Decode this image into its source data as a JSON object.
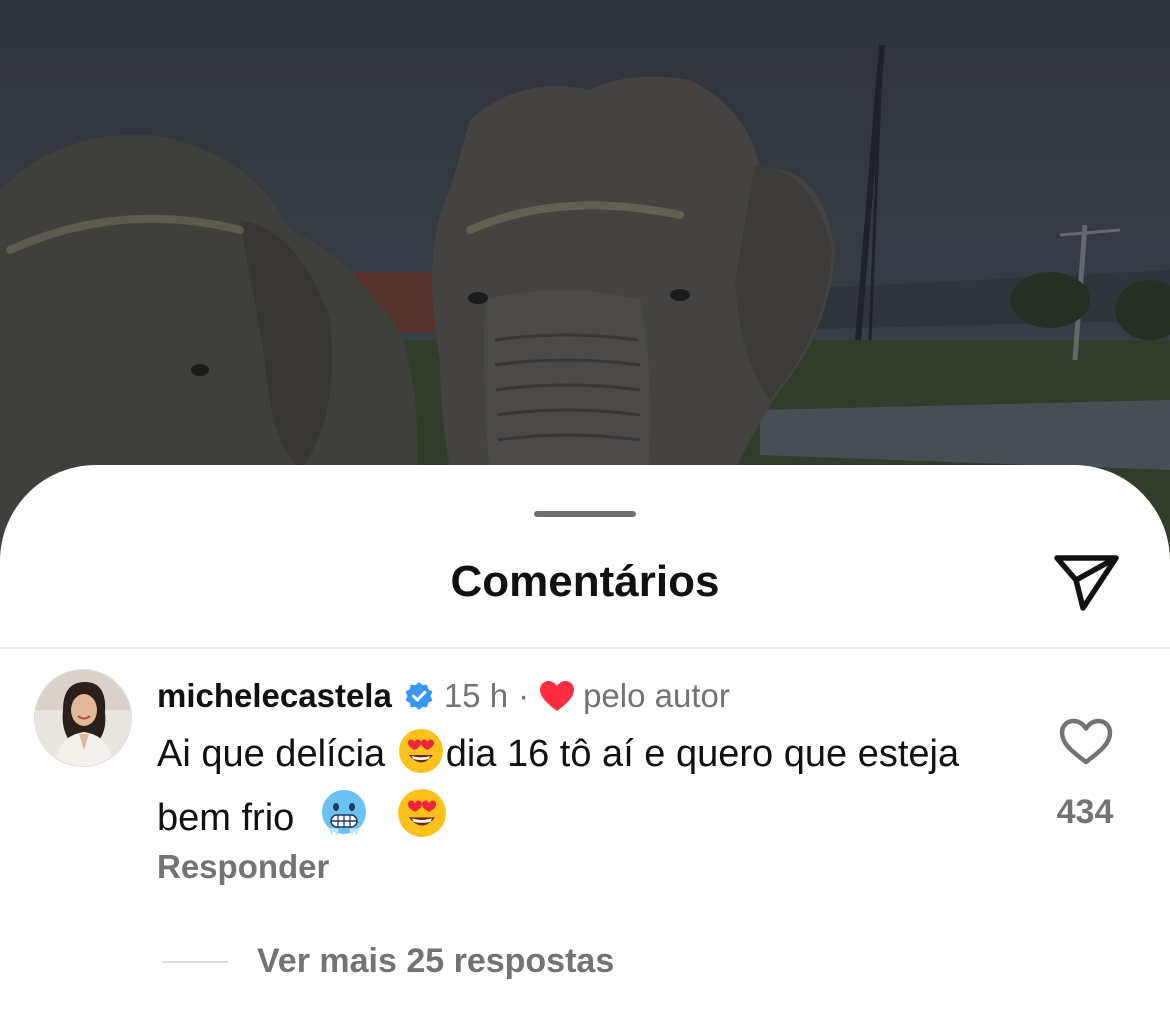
{
  "sheet": {
    "title": "Comentários"
  },
  "icons": {
    "share": "paper-plane-icon",
    "verified": "verified-badge-icon",
    "author_like": "red-heart-icon",
    "like": "heart-outline-icon"
  },
  "comment": {
    "username": "michelecastela",
    "time": "15 h",
    "separator": "·",
    "author_like_label": "pelo autor",
    "text_part1": "Ai que delícia",
    "text_part2": "dia 16 tô aí e quero que esteja bem frio",
    "emojis": [
      "smiling-face-with-heart-eyes",
      "cold-face",
      "smiling-face-with-heart-eyes"
    ],
    "reply_label": "Responder",
    "like_count": "434"
  },
  "replies": {
    "more_label": "Ver mais 25 respostas"
  },
  "colors": {
    "accent_blue": "#3897f0",
    "heart_red": "#ff2d3f",
    "muted_text": "#737373"
  }
}
